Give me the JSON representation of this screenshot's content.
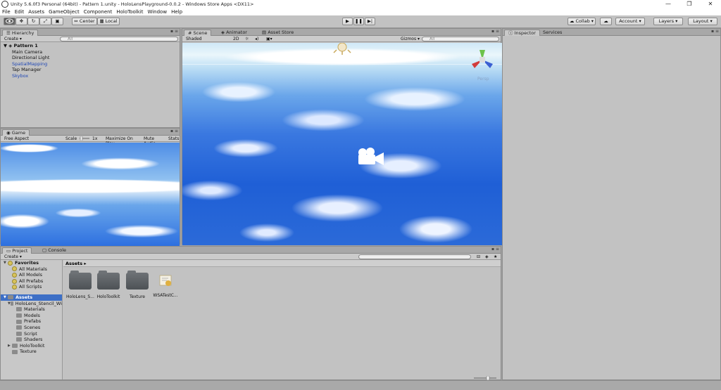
{
  "window": {
    "title": "Unity 5.6.0f3 Personal (64bit) - Pattern 1.unity - HoloLensPlayground-0.0.2 - Windows Store Apps <DX11>",
    "min": "—",
    "max": "❐",
    "close": "✕"
  },
  "menu": [
    "File",
    "Edit",
    "Assets",
    "GameObject",
    "Component",
    "HoloToolkit",
    "Window",
    "Help"
  ],
  "toolbar": {
    "center": "Center",
    "local": "Local",
    "collab": "Collab ▾",
    "account": "Account ▾",
    "layers": "Layers ▾",
    "layout": "Layout ▾"
  },
  "hierarchy": {
    "tab": "Hierarchy",
    "create": "Create ▾",
    "search_placeholder": "All",
    "scene_name": "Pattern 1",
    "items": [
      {
        "label": "Main Camera"
      },
      {
        "label": "Directional Light"
      },
      {
        "label": "SpatialMapping"
      },
      {
        "label": "Tap Manager"
      },
      {
        "label": "Skybox"
      }
    ]
  },
  "scene": {
    "tabs": [
      "Scene",
      "Animator",
      "Asset Store"
    ],
    "shading": "Shaded",
    "mode_2d": "2D",
    "gizmos": "Gizmos ▾",
    "search_placeholder": "All",
    "persp": "Persp"
  },
  "game": {
    "tab": "Game",
    "aspect": "Free Aspect",
    "scale_label": "Scale",
    "scale_value": "1x",
    "maximize": "Maximize On Play",
    "mute": "Mute Audio",
    "stats": "Stats"
  },
  "inspector": {
    "tabs": [
      "Inspector",
      "Services"
    ]
  },
  "project": {
    "tabs": [
      "Project",
      "Console"
    ],
    "create": "Create ▾",
    "breadcrumb": "Assets ▸",
    "favorites_label": "Favorites",
    "favorites": [
      "All Materials",
      "All Models",
      "All Prefabs",
      "All Scripts"
    ],
    "assets_label": "Assets",
    "tree": [
      {
        "label": "HoloLens_Stencil_Wi"
      },
      {
        "label": "Materials"
      },
      {
        "label": "Models"
      },
      {
        "label": "Prefabs"
      },
      {
        "label": "Scenes"
      },
      {
        "label": "Script"
      },
      {
        "label": "Shaders"
      },
      {
        "label": "HoloToolkit"
      },
      {
        "label": "Texture"
      }
    ],
    "grid_assets": [
      {
        "label": "HoloLens_S..."
      },
      {
        "label": "HoloToolkit"
      },
      {
        "label": "Texture"
      },
      {
        "label": "WSATestC..."
      }
    ]
  }
}
